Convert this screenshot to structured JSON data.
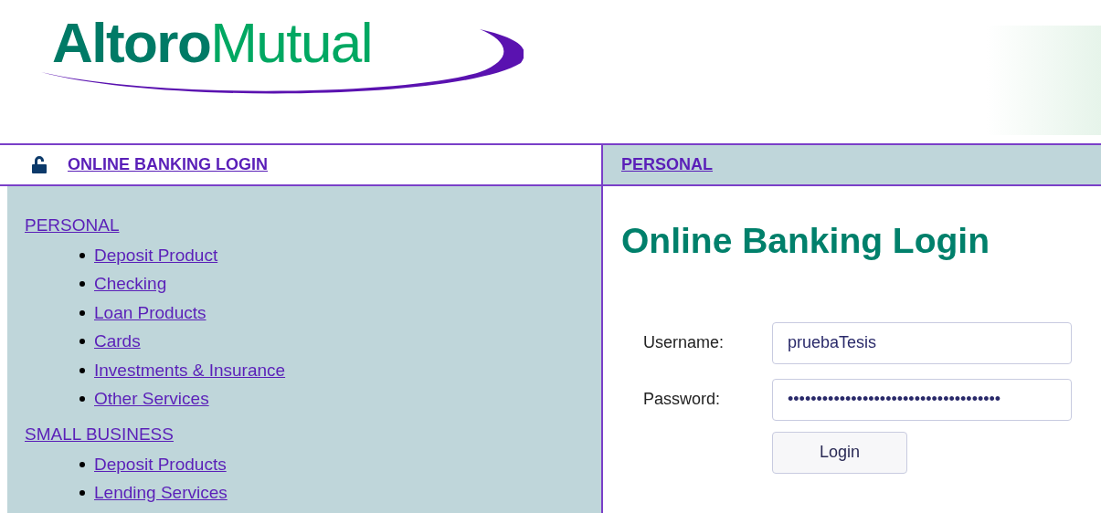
{
  "logo": {
    "part_1": "Altoro",
    "part_2": "Mutual"
  },
  "nav": {
    "login_link": "ONLINE BANKING LOGIN",
    "section_link": "PERSONAL"
  },
  "sidebar": {
    "groups": [
      {
        "label": "PERSONAL",
        "items": [
          "Deposit Product",
          "Checking",
          "Loan Products",
          "Cards",
          "Investments & Insurance",
          "Other Services"
        ]
      },
      {
        "label": "SMALL BUSINESS",
        "items": [
          "Deposit Products",
          "Lending Services"
        ]
      }
    ]
  },
  "main": {
    "title": "Online Banking Login",
    "fields": [
      {
        "label": "Username:",
        "value": "pruebaTesis"
      },
      {
        "label": "Password:",
        "value": "•••••••••••••••••••••••••••••••••••••"
      }
    ],
    "button": "Login"
  }
}
